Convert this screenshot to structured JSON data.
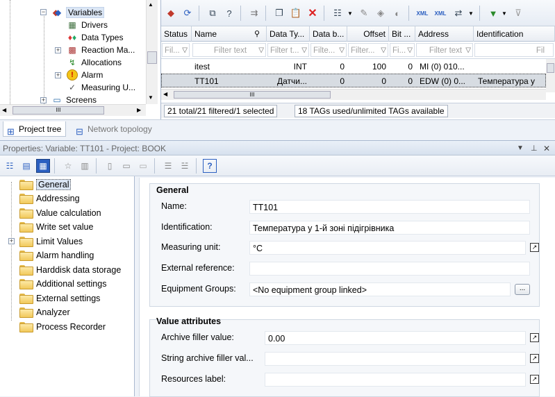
{
  "tree": {
    "items": [
      {
        "label": "Variables",
        "icon": "variables-icon",
        "selected": true
      },
      {
        "label": "Drivers",
        "icon": "drivers-icon"
      },
      {
        "label": "Data Types",
        "icon": "data-types-icon"
      },
      {
        "label": "Reaction Ma...",
        "icon": "reaction-matrix-icon"
      },
      {
        "label": "Allocations",
        "icon": "allocations-icon"
      },
      {
        "label": "Alarm",
        "icon": "alarm-icon"
      },
      {
        "label": "Measuring U...",
        "icon": "measuring-units-icon"
      },
      {
        "label": "Screens",
        "icon": "screens-icon"
      }
    ]
  },
  "grid": {
    "columns": [
      "Status",
      "Name",
      "Data Ty...",
      "Data b...",
      "Offset",
      "Bit ...",
      "Address",
      "Identification"
    ],
    "filters": [
      "Fil...",
      "Filter text",
      "Filter t...",
      "Filte...",
      "Filter...",
      "Fi...",
      "Filter text",
      "Fil"
    ],
    "rows": [
      {
        "status": "",
        "name": "itest",
        "data_type": "INT",
        "data_block": "0",
        "offset": "100",
        "bit": "0",
        "address": "MI (0) 010...",
        "identification": ""
      },
      {
        "status": "",
        "name": "TT101",
        "data_type": "Датчи...",
        "data_block": "0",
        "offset": "0",
        "bit": "0",
        "address": "EDW (0) 0...",
        "identification": "Температура у"
      }
    ],
    "status_filtered": "21 total/21 filtered/1 selected",
    "status_tags": "18 TAGs used/unlimited TAGs available"
  },
  "tabs": [
    {
      "label": "Project tree",
      "icon": "project-tree-icon",
      "active": true
    },
    {
      "label": "Network topology",
      "icon": "network-topology-icon",
      "active": false
    }
  ],
  "properties": {
    "title": "Properties: Variable: TT101 - Project: BOOK",
    "categories": [
      "General",
      "Addressing",
      "Value calculation",
      "Write set value",
      "Limit Values",
      "Alarm handling",
      "Harddisk data storage",
      "Additional settings",
      "External settings",
      "Analyzer",
      "Process Recorder"
    ],
    "general": {
      "title": "General",
      "name_label": "Name:",
      "name_value": "TT101",
      "identification_label": "Identification:",
      "identification_value": "Температура у 1-й зоні підігрівника",
      "unit_label": "Measuring unit:",
      "unit_value": "°C",
      "external_ref_label": "External reference:",
      "external_ref_value": "",
      "equipment_label": "Equipment Groups:",
      "equipment_value": "<No equipment group linked>",
      "browse_label": "..."
    },
    "value_attributes": {
      "title": "Value attributes",
      "archive_filler_label": "Archive filler value:",
      "archive_filler_value": "0.00",
      "string_filler_label": "String archive filler val...",
      "string_filler_value": "",
      "resources_label": "Resources label:",
      "resources_value": ""
    }
  },
  "colors": {
    "selection": "#dbe6f5",
    "folder": "#f1c95b",
    "panel_bg": "#eef2f8"
  }
}
